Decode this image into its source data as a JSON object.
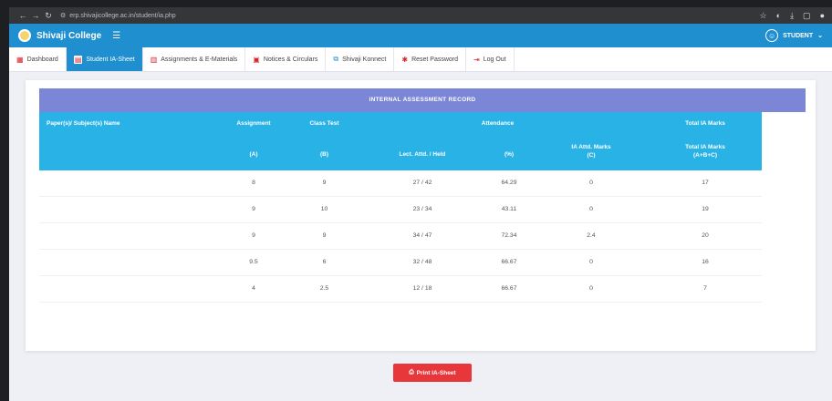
{
  "browser": {
    "url": "erp.shivajicollege.ac.in/student/ia.php"
  },
  "app": {
    "brand": "Shivaji College",
    "user_label": "STUDENT"
  },
  "tabs": [
    {
      "label": "Dashboard",
      "icon": "dashboard-icon"
    },
    {
      "label": "Student IA-Sheet",
      "icon": "sheet-icon",
      "active": true
    },
    {
      "label": "Assignments & E-Materials",
      "icon": "book-icon"
    },
    {
      "label": "Notices & Circulars",
      "icon": "notice-icon"
    },
    {
      "label": "Shivaji Konnect",
      "icon": "network-icon"
    },
    {
      "label": "Reset Password",
      "icon": "gear-icon"
    },
    {
      "label": "Log Out",
      "icon": "logout-icon"
    }
  ],
  "table": {
    "title": "INTERNAL ASSESSMENT RECORD",
    "headers": {
      "subject": "Paper(s)/ Subject(s) Name",
      "assignment": "Assignment",
      "class_test": "Class Test",
      "attendance": "Attendance",
      "total": "Total IA Marks",
      "a": "(A)",
      "b": "(B)",
      "lect": "Lect. Attd. / Held",
      "pct": "(%)",
      "ia_attd": "IA Attd. Marks",
      "c": "(C)",
      "total2": "Total IA Marks",
      "abc": "(A+B+C)"
    },
    "rows": [
      {
        "assignment": "8",
        "class_test": "9",
        "lect": "27 / 42",
        "pct": "64.29",
        "ia": "0",
        "total": "17"
      },
      {
        "assignment": "9",
        "class_test": "10",
        "lect": "23 / 34",
        "pct": "43.11",
        "ia": "0",
        "total": "19"
      },
      {
        "assignment": "9",
        "class_test": "9",
        "lect": "34 / 47",
        "pct": "72.34",
        "ia": "2.4",
        "total": "20"
      },
      {
        "assignment": "9.5",
        "class_test": "6",
        "lect": "32 / 48",
        "pct": "66.67",
        "ia": "0",
        "total": "16"
      },
      {
        "assignment": "4",
        "class_test": "2.5",
        "lect": "12 / 18",
        "pct": "66.67",
        "ia": "0",
        "total": "7"
      }
    ]
  },
  "print_button": "Print IA-Sheet"
}
